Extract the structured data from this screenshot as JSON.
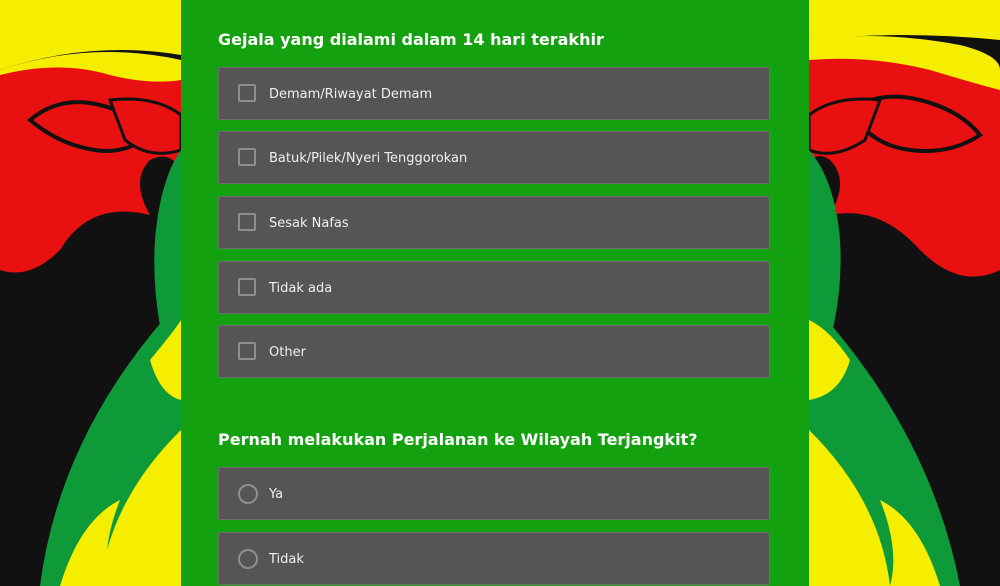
{
  "questions": [
    {
      "title": "Gejala yang dialami dalam 14 hari terakhir",
      "type": "checkbox",
      "options": [
        "Demam/Riwayat Demam",
        "Batuk/Pilek/Nyeri Tenggorokan",
        "Sesak Nafas",
        "Tidak ada",
        "Other"
      ]
    },
    {
      "title": "Pernah melakukan Perjalanan ke Wilayah Terjangkit?",
      "type": "radio",
      "options": [
        "Ya",
        "Tidak"
      ]
    }
  ],
  "colors": {
    "form_background": "#14a10f",
    "option_background": "#555555",
    "control_border": "#8f8f8f",
    "emblem_yellow": "#f5ee00",
    "emblem_red": "#e81010",
    "emblem_green": "#0f9a3a",
    "emblem_black": "#111111"
  }
}
